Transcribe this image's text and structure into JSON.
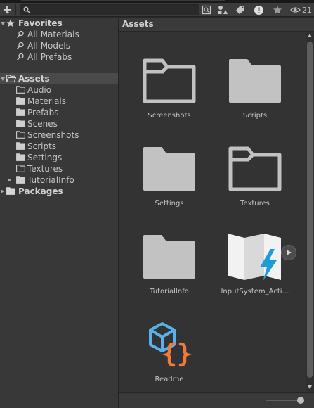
{
  "toolbar": {
    "add_label": "+",
    "search": {
      "value": "",
      "placeholder": ""
    },
    "hidden_packages_count": "21"
  },
  "tree": {
    "favorites": {
      "label": "Favorites",
      "items": [
        {
          "label": "All Materials"
        },
        {
          "label": "All Models"
        },
        {
          "label": "All Prefabs"
        }
      ]
    },
    "assets": {
      "label": "Assets",
      "children": [
        {
          "label": "Audio"
        },
        {
          "label": "Materials"
        },
        {
          "label": "Prefabs"
        },
        {
          "label": "Scenes"
        },
        {
          "label": "Screenshots"
        },
        {
          "label": "Scripts"
        },
        {
          "label": "Settings"
        },
        {
          "label": "Textures"
        },
        {
          "label": "TutorialInfo"
        }
      ]
    },
    "packages": {
      "label": "Packages"
    }
  },
  "content": {
    "breadcrumb": "Assets",
    "items": [
      {
        "name": "Screenshots",
        "icon": "folder-empty-icon"
      },
      {
        "name": "Scripts",
        "icon": "folder-icon"
      },
      {
        "name": "Settings",
        "icon": "folder-icon"
      },
      {
        "name": "Textures",
        "icon": "folder-empty-icon"
      },
      {
        "name": "TutorialInfo",
        "icon": "folder-icon"
      },
      {
        "name": "InputSystem_Acti…",
        "icon": "input-actions-icon"
      },
      {
        "name": "Readme",
        "icon": "readme-icon"
      }
    ]
  },
  "colors": {
    "panel_bg": "#383838",
    "content_bg": "#333333",
    "folder_fill": "#c2c2c2",
    "readme_blue": "#5ab0e8",
    "readme_orange": "#f07a3c",
    "input_blue": "#1e9bd8"
  }
}
